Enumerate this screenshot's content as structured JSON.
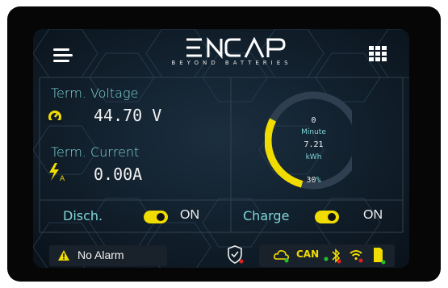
{
  "header": {
    "brand": "ENCAP",
    "tagline": "BEYOND BATTERIES"
  },
  "voltage": {
    "label": "Term. Voltage",
    "value": "44.70 V"
  },
  "current": {
    "label": "Term. Current",
    "value": "0.00A"
  },
  "gauge": {
    "minutes": "0",
    "minutes_label": "Minute",
    "energy": "7.21",
    "energy_unit": "kWh",
    "soc": "30",
    "soc_unit": "%",
    "soc_fraction": 0.3
  },
  "discharge": {
    "label": "Disch.",
    "state": "ON"
  },
  "charge": {
    "label": "Charge",
    "state": "ON"
  },
  "footer": {
    "alarm": "No Alarm",
    "can_label": "CAN"
  },
  "colors": {
    "accent": "#f0dc00",
    "label": "#7fd6d8",
    "screen_bg": "#0c1722",
    "bezel": "#060607"
  }
}
